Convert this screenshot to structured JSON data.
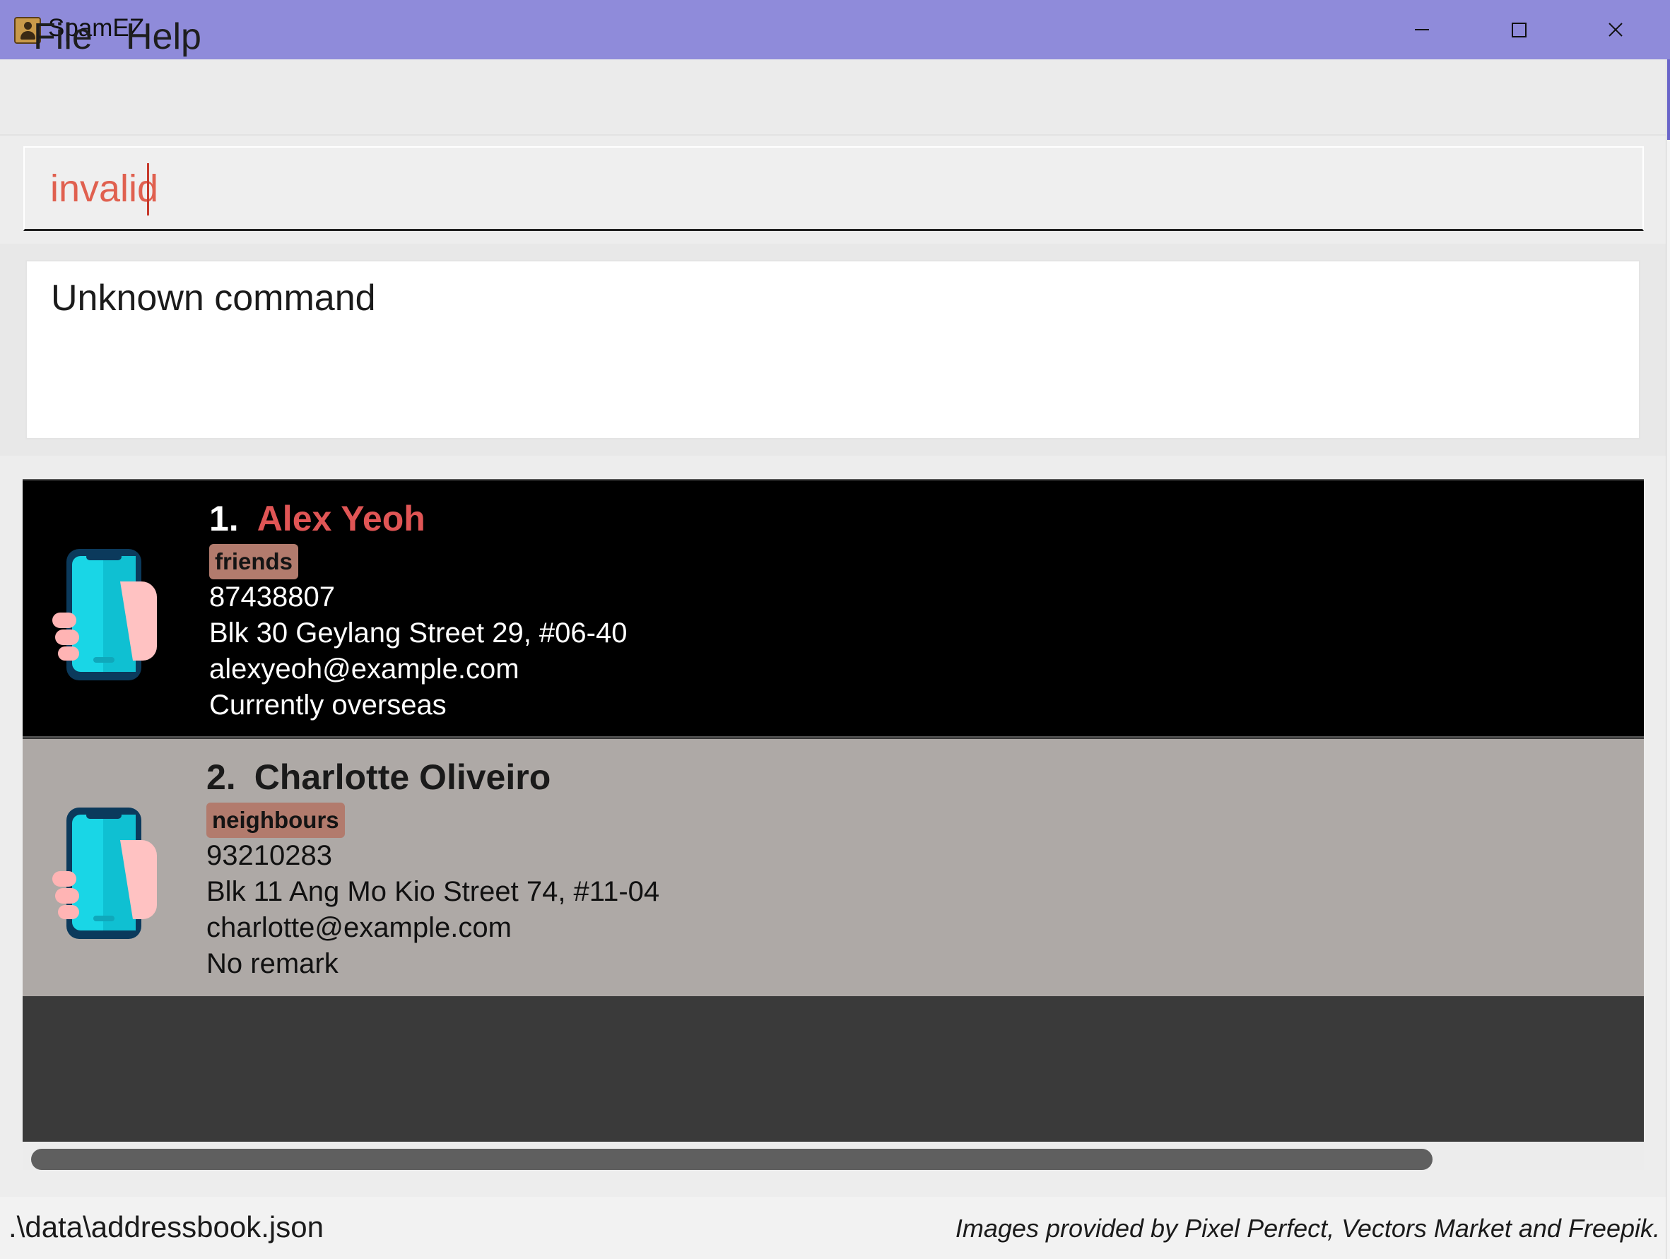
{
  "window": {
    "title": "SpamEZ",
    "controls": [
      "minimize",
      "maximize",
      "close"
    ]
  },
  "menu": {
    "items": [
      {
        "label": "File"
      },
      {
        "label": "Help"
      }
    ]
  },
  "command_box": {
    "value": "invalid",
    "text_color": "#e0604f"
  },
  "result_display": {
    "text": "Unknown command"
  },
  "person_list": {
    "persons": [
      {
        "index": "1.",
        "name": "Alex Yeoh",
        "tag": "friends",
        "phone": "87438807",
        "address": "Blk 30 Geylang Street 29, #06-40",
        "email": "alexyeoh@example.com",
        "remark": "Currently overseas",
        "selected": true,
        "name_color": "#e05555",
        "background": "#000000"
      },
      {
        "index": "2.",
        "name": "Charlotte Oliveiro",
        "tag": "neighbours",
        "phone": "93210283",
        "address": "Blk 11 Ang Mo Kio Street 74, #11-04",
        "email": "charlotte@example.com",
        "remark": "No remark",
        "selected": false,
        "name_color": "#1a1a1a",
        "background": "#aea9a6"
      }
    ],
    "avatar_icon": "hand-holding-phone-icon",
    "tag_color": "#b27b6d"
  },
  "status_bar": {
    "file_path": ".\\data\\addressbook.json",
    "credits": "Images provided by Pixel Perfect, Vectors Market and Freepik."
  },
  "colors": {
    "title_bar": "#8f8bda",
    "list_background": "#3a3a3a"
  }
}
